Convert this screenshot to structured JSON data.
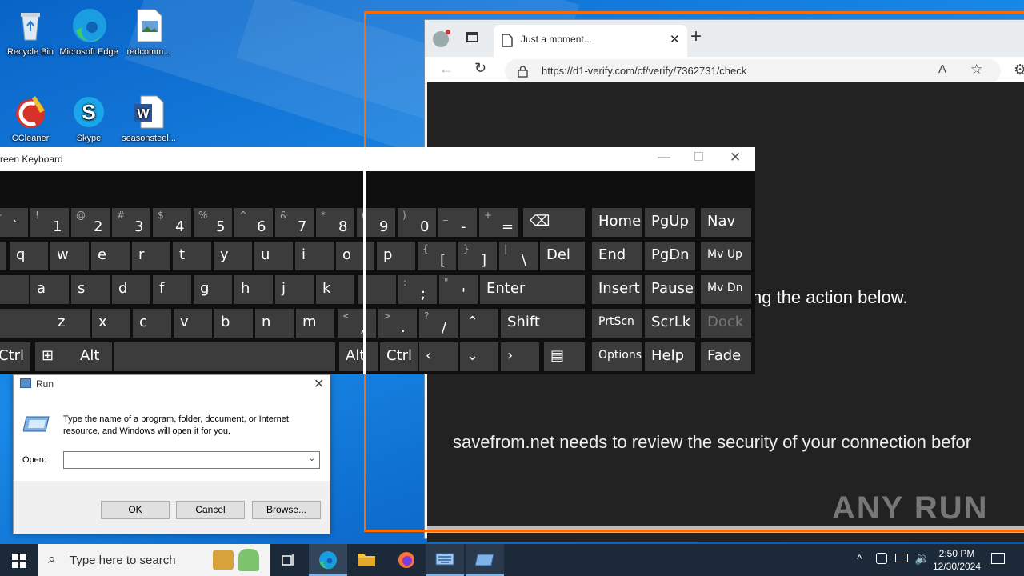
{
  "desktop": {
    "icons": [
      {
        "label": "Recycle Bin"
      },
      {
        "label": "Microsoft Edge"
      },
      {
        "label": "redcomm..."
      },
      {
        "label": "CCleaner"
      },
      {
        "label": "Skype"
      },
      {
        "label": "seasonsteel..."
      }
    ]
  },
  "browser": {
    "tab_title": "Just a moment...",
    "url": "https://d1-verify.com/cf/verify/7362731/check",
    "page_text_1": "ng the action below.",
    "page_text_2": "savefrom.net needs to review the security of your connection befor",
    "watermark": "ANY RUN"
  },
  "osk": {
    "title": "reen Keyboard",
    "rows": [
      [
        {
          "s": "~",
          "m": "`"
        },
        {
          "s": "!",
          "m": "1"
        },
        {
          "s": "@",
          "m": "2"
        },
        {
          "s": "#",
          "m": "3"
        },
        {
          "s": "$",
          "m": "4"
        },
        {
          "s": "%",
          "m": "5"
        },
        {
          "s": "^",
          "m": "6"
        },
        {
          "s": "&",
          "m": "7"
        },
        {
          "s": "*",
          "m": "8"
        },
        {
          "s": "(",
          "m": "9"
        },
        {
          "s": ")",
          "m": "0"
        },
        {
          "s": "_",
          "m": "-"
        },
        {
          "s": "+",
          "m": "="
        }
      ],
      [
        "q",
        "w",
        "e",
        "r",
        "t",
        "y",
        "u",
        "i",
        "o",
        "p"
      ],
      [
        "a",
        "s",
        "d",
        "f",
        "g",
        "h",
        "j",
        "k"
      ],
      [
        "z",
        "x",
        "c",
        "v",
        "b",
        "n",
        "m"
      ]
    ],
    "row2_sym": [
      {
        "s": "{",
        "m": "["
      },
      {
        "s": "}",
        "m": "]"
      },
      {
        "s": "|",
        "m": "\\"
      }
    ],
    "row3_sym": [
      {
        "s": ":",
        "m": ";"
      },
      {
        "s": "\"",
        "m": "'"
      }
    ],
    "row4_sym": [
      {
        "s": "<",
        "m": ","
      },
      {
        "s": ">",
        "m": "."
      },
      {
        "s": "?",
        "m": "/"
      }
    ],
    "labels": {
      "del": "Del",
      "enter": "Enter",
      "shift": "Shift",
      "ctrl": "Ctrl",
      "alt": "Alt",
      "ctrl_r": "Ctrl",
      "alt_r": "Alt",
      "home": "Home",
      "pgup": "PgUp",
      "nav": "Nav",
      "end": "End",
      "pgdn": "PgDn",
      "mvup": "Mv Up",
      "insert": "Insert",
      "pause": "Pause",
      "mvdn": "Mv Dn",
      "prtscn": "PrtScn",
      "scrlk": "ScrLk",
      "dock": "Dock",
      "options": "Options",
      "help": "Help",
      "fade": "Fade"
    }
  },
  "run_dialog": {
    "title": "Run",
    "description": "Type the name of a program, folder, document, or Internet resource, and Windows will open it for you.",
    "open_label": "Open:",
    "open_value": "",
    "ok": "OK",
    "cancel": "Cancel",
    "browse": "Browse..."
  },
  "taskbar": {
    "search_placeholder": "Type here to search",
    "time": "2:50 PM",
    "date": "12/30/2024"
  }
}
